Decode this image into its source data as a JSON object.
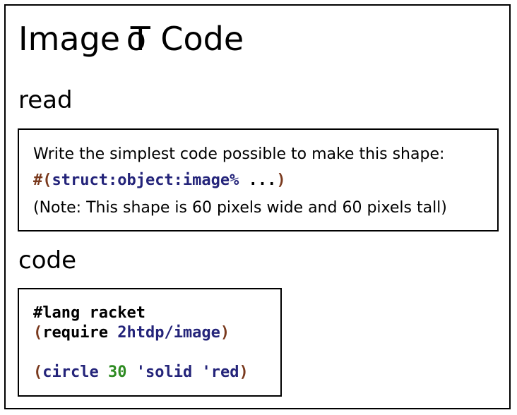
{
  "title": {
    "before": "Image ",
    "middle": "T",
    "middle_overlay": "o",
    "after": " Code"
  },
  "sections": {
    "read_label": "read",
    "code_label": "code"
  },
  "read": {
    "line1": "Write the simplest code possible to make this shape:",
    "line2": {
      "hash": "#",
      "open": "(",
      "ident": "struct:object:image%",
      "rest": " ...",
      "close": ")"
    },
    "line3": "(Note: This shape is 60 pixels wide and 60 pixels tall)"
  },
  "code": {
    "line1": "#lang racket",
    "line2": {
      "open": "(",
      "keyword": "require",
      "space": " ",
      "module": "2htdp/image",
      "close": ")"
    },
    "line3": {
      "open": "(",
      "func": "circle",
      "sp1": " ",
      "radius": "30",
      "sp2": " ",
      "mode": "'solid",
      "sp3": " ",
      "color": "'red",
      "close": ")"
    }
  },
  "colors": {
    "paren": "#7a3a1e",
    "identifier": "#24247a",
    "number": "#2e8b22"
  }
}
